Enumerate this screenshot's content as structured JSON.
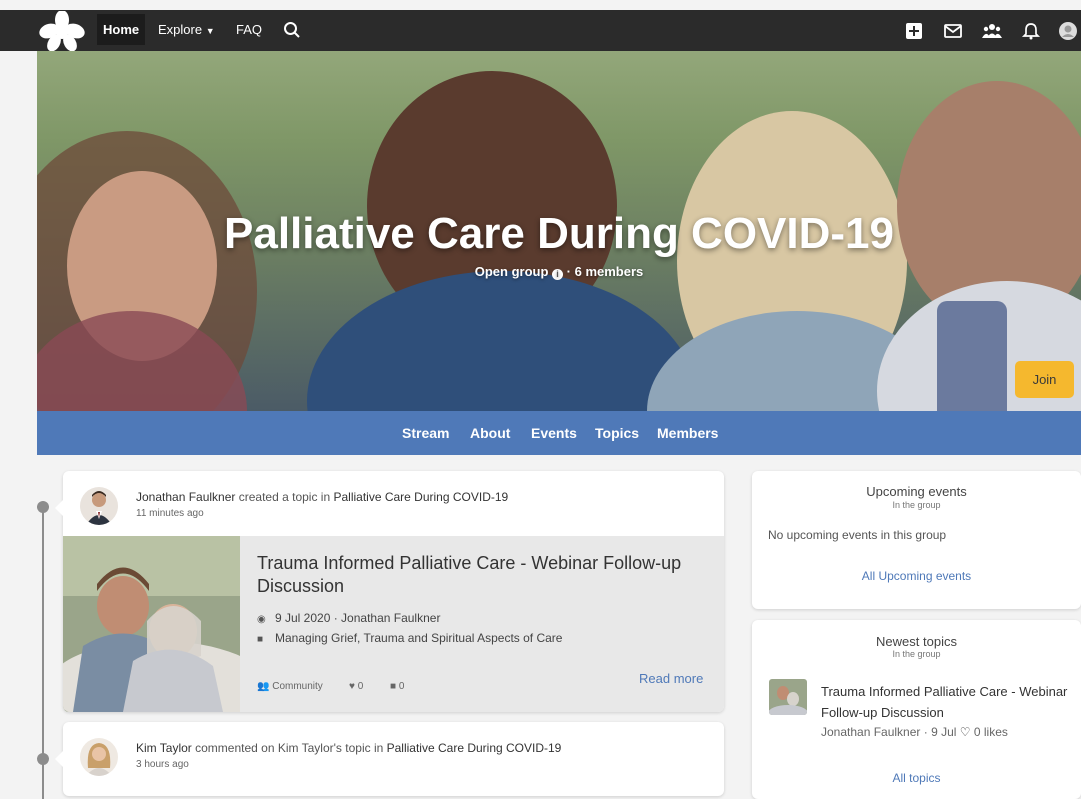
{
  "nav": {
    "home": "Home",
    "explore": "Explore",
    "faq": "FAQ"
  },
  "icons": {
    "logo": "flower-logo-icon",
    "search": "search-icon",
    "add": "plus-square-icon",
    "mail": "envelope-icon",
    "groups": "people-icon",
    "bell": "bell-icon",
    "user": "user-avatar-icon"
  },
  "hero": {
    "title": "Palliative Care During COVID-19",
    "type": "Open group",
    "members": " · 6 members",
    "join": "Join"
  },
  "tabs": [
    "Stream",
    "About",
    "Events",
    "Topics",
    "Members"
  ],
  "stream": [
    {
      "actor": "Jonathan Faulkner",
      "action": " created a topic in ",
      "target": "Palliative Care During COVID-19",
      "time": "11 minutes ago",
      "post": {
        "title": "Trauma Informed Palliative Care - Webinar Follow-up Discussion",
        "date_author": "9 Jul 2020 · Jonathan Faulkner",
        "tag": "Managing Grief, Trauma and Spiritual Aspects of Care",
        "visibility": "Community",
        "likes": "0",
        "comments": "0",
        "read_more": "Read more"
      }
    },
    {
      "actor": "Kim Taylor",
      "action": " commented on Kim Taylor's topic in ",
      "target": "Palliative Care During COVID-19",
      "time": "3 hours ago"
    }
  ],
  "sidebar": {
    "upcoming": {
      "heading": "Upcoming events",
      "sub": "In the group",
      "empty": "No upcoming events in this group",
      "link": "All Upcoming events"
    },
    "topics": {
      "heading": "Newest topics",
      "sub": "In the group",
      "item_title": "Trauma Informed Palliative Care - Webinar Follow-up Discussion",
      "item_meta": "Jonathan Faulkner · 9 Jul",
      "item_likes": "0 likes",
      "link": "All topics"
    }
  },
  "colors": {
    "navbar": "#2b2b2b",
    "tabbar": "#4f79b8",
    "join": "#f5b82e",
    "link": "#4f79b8"
  }
}
